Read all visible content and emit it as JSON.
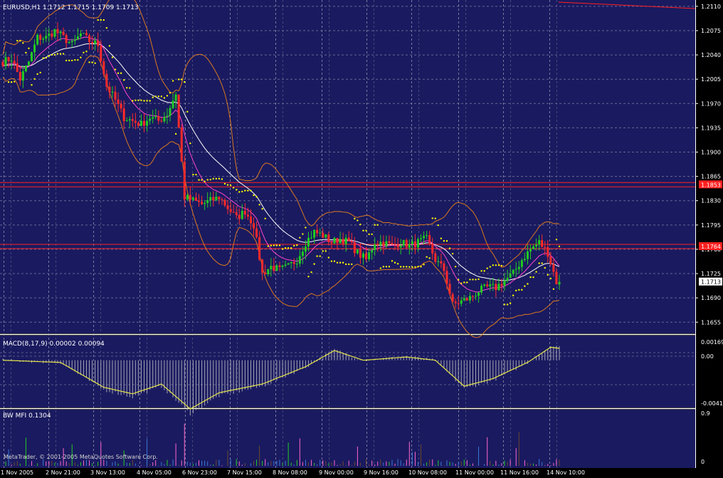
{
  "header": {
    "symbol_info": "EURUSD,H1  1.1712 1.1715 1.1709 1.1713"
  },
  "macd_panel": {
    "label": "MACD(8,17,9) 0.00002 0.00094",
    "ticks": [
      "0.00169",
      "0.00",
      "-0.0041"
    ]
  },
  "mfi_panel": {
    "label": "BW MFI 0.1304",
    "ticks": [
      "0.9",
      "0"
    ],
    "copyright": "MetaTrader, © 2001-2005 MetaQuotes Software Corp."
  },
  "price_axis": {
    "ticks": [
      "1.2110",
      "1.2075",
      "1.2040",
      "1.2005",
      "1.1970",
      "1.1935",
      "1.1900",
      "1.1865",
      "1.1830",
      "1.1795",
      "1.1760",
      "1.1725",
      "1.1690",
      "1.1655"
    ],
    "hline_labels": [
      "1.1853",
      "1.1764"
    ],
    "current_price": "1.1713"
  },
  "time_axis": {
    "labels": [
      "1 Nov 2005",
      "2 Nov 21:00",
      "3 Nov 13:00",
      "4 Nov 05:00",
      "6 Nov 23:00",
      "7 Nov 15:00",
      "8 Nov 08:00",
      "9 Nov 00:00",
      "9 Nov 16:00",
      "10 Nov 08:00",
      "11 Nov 00:00",
      "11 Nov 16:00",
      "14 Nov 10:00"
    ]
  },
  "colors": {
    "background": "#1a1a60",
    "axis_bg": "#000000",
    "bull_candle": "#22cc22",
    "bear_candle": "#ff2a2a",
    "bollinger": "#d9781e",
    "ma_fast": "#ff44cc",
    "ma_slow": "#ffffff",
    "parabolic_sar": "#ffff00",
    "macd_signal": "#e6e64a",
    "macd_hist": "#c8c8c8",
    "hline": "#ff2020",
    "grid": "#9a9ab4"
  },
  "chart_data": {
    "type": "candlestick",
    "symbol": "EURUSD",
    "timeframe": "H1",
    "ylim": [
      1.1645,
      1.2115
    ],
    "horizontal_lines": [
      1.1853,
      1.1764
    ],
    "last_close": 1.1713,
    "price_path": [
      [
        0,
        1.203
      ],
      [
        3,
        1.2035
      ],
      [
        6,
        1.2005
      ],
      [
        9,
        1.203
      ],
      [
        12,
        1.2065
      ],
      [
        15,
        1.2065
      ],
      [
        18,
        1.2075
      ],
      [
        21,
        1.2065
      ],
      [
        24,
        1.2055
      ],
      [
        27,
        1.207
      ],
      [
        30,
        1.206
      ],
      [
        33,
        1.2055
      ],
      [
        36,
        1.1995
      ],
      [
        39,
        1.1975
      ],
      [
        42,
        1.195
      ],
      [
        45,
        1.1945
      ],
      [
        48,
        1.194
      ],
      [
        51,
        1.195
      ],
      [
        54,
        1.1945
      ],
      [
        57,
        1.1955
      ],
      [
        60,
        1.1985
      ],
      [
        63,
        1.1835
      ],
      [
        66,
        1.183
      ],
      [
        69,
        1.1825
      ],
      [
        72,
        1.183
      ],
      [
        75,
        1.1835
      ],
      [
        78,
        1.182
      ],
      [
        81,
        1.1805
      ],
      [
        84,
        1.1815
      ],
      [
        87,
        1.1795
      ],
      [
        90,
        1.1725
      ],
      [
        93,
        1.1735
      ],
      [
        96,
        1.173
      ],
      [
        99,
        1.1735
      ],
      [
        102,
        1.1745
      ],
      [
        105,
        1.177
      ],
      [
        108,
        1.1785
      ],
      [
        111,
        1.178
      ],
      [
        114,
        1.177
      ],
      [
        117,
        1.1775
      ],
      [
        120,
        1.177
      ],
      [
        123,
        1.1755
      ],
      [
        126,
        1.1745
      ],
      [
        129,
        1.177
      ],
      [
        132,
        1.177
      ],
      [
        135,
        1.1765
      ],
      [
        138,
        1.177
      ],
      [
        141,
        1.1765
      ],
      [
        144,
        1.177
      ],
      [
        147,
        1.1775
      ],
      [
        150,
        1.1745
      ],
      [
        153,
        1.173
      ],
      [
        156,
        1.168
      ],
      [
        159,
        1.1685
      ],
      [
        162,
        1.169
      ],
      [
        165,
        1.17
      ],
      [
        168,
        1.1705
      ],
      [
        171,
        1.1705
      ],
      [
        174,
        1.1715
      ],
      [
        177,
        1.1725
      ],
      [
        180,
        1.1745
      ],
      [
        183,
        1.176
      ],
      [
        186,
        1.177
      ],
      [
        189,
        1.1755
      ],
      [
        192,
        1.1713
      ]
    ],
    "macd": {
      "params": [
        8,
        17,
        9
      ],
      "ylim": [
        -0.0041,
        0.00169
      ],
      "signal_path": [
        [
          0,
          0.0
        ],
        [
          20,
          -0.0002
        ],
        [
          35,
          -0.0025
        ],
        [
          45,
          -0.0031
        ],
        [
          55,
          -0.0022
        ],
        [
          65,
          -0.0045
        ],
        [
          75,
          -0.003
        ],
        [
          90,
          -0.0022
        ],
        [
          105,
          -0.0006
        ],
        [
          115,
          0.0009
        ],
        [
          125,
          0.0
        ],
        [
          140,
          0.0003
        ],
        [
          150,
          0.0
        ],
        [
          160,
          -0.0024
        ],
        [
          170,
          -0.0017
        ],
        [
          182,
          -0.0002
        ],
        [
          190,
          0.0012
        ],
        [
          193,
          0.0011
        ]
      ]
    },
    "bw_mfi": {
      "ylim": [
        0,
        0.9
      ],
      "value": 0.1304
    }
  }
}
